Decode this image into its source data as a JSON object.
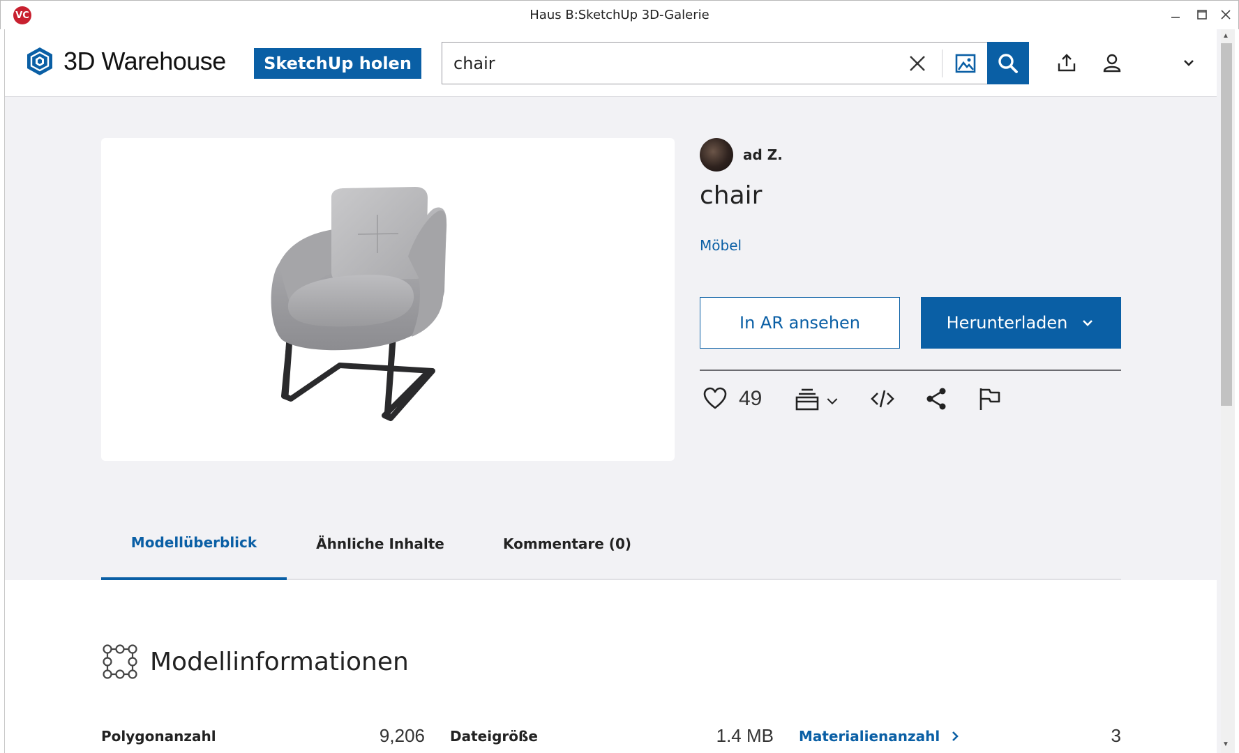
{
  "window": {
    "title": "Haus B:SketchUp 3D-Galerie",
    "app_icon_text": "VC"
  },
  "header": {
    "logo_text": "3D Warehouse",
    "get_sketchup_label": "SketchUp holen",
    "search_value": "chair"
  },
  "model": {
    "author_name": "ad Z.",
    "title": "chair",
    "category": "Möbel",
    "ar_label": "In AR ansehen",
    "download_label": "Herunterladen",
    "like_count": "49"
  },
  "tabs": [
    {
      "label": "Modellüberblick",
      "active": true
    },
    {
      "label": "Ähnliche Inhalte",
      "active": false
    },
    {
      "label": "Kommentare (0)",
      "active": false
    }
  ],
  "model_info": {
    "title": "Modellinformationen",
    "items": [
      {
        "label": "Polygonanzahl",
        "value": "9,206"
      },
      {
        "label": "Dateigröße",
        "value": "1.4 MB"
      },
      {
        "label": "Materialienanzahl",
        "value": "3"
      }
    ]
  },
  "colors": {
    "brand_blue": "#0a5fa5",
    "page_bg": "#f2f2f5"
  }
}
